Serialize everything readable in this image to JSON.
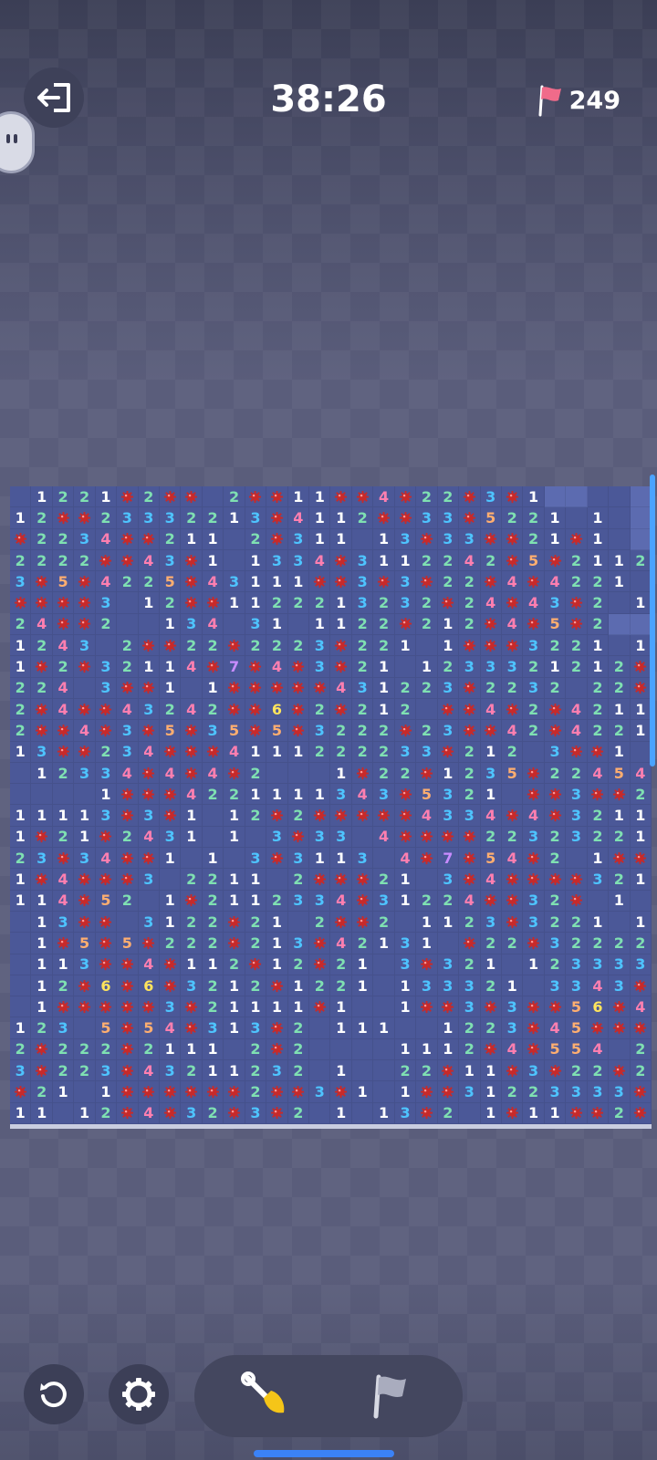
{
  "header": {
    "timer": "38:26",
    "flags_remaining": "249"
  },
  "icons": {
    "exit": "exit-icon",
    "mascot": "mascot-avatar",
    "flag": "flag-icon",
    "restart": "restart-icon",
    "settings": "gear-icon",
    "dig_mode": "shovel-icon",
    "flag_mode": "flag-mode-icon",
    "mine": "mine-icon"
  },
  "colors": {
    "1": "#ffffff",
    "2": "#7fe0b2",
    "3": "#4ec4ff",
    "4": "#ff7fb0",
    "5": "#ffae70",
    "6": "#ffe45c",
    "7": "#c98cff",
    "mine": "#c72a2a"
  },
  "board": {
    "cols": 30,
    "legend": "'.'=hidden, ' '=empty, 1-7=number, '*'=mine",
    "rows": [
      " 1221*2** 2**11**4*22*3*1..  .",
      "12**23332213*4112**33*5221 1 .",
      "*2234**211 2*311 13*33**21*1 .",
      "2222**43*1 1334*3112242*5*2112",
      "3*5*4225*43111**3*3*22*4*4221 ",
      "****3 12**1122213232*24*43*2 1",
      "24**2  134 31 1122*212*4*5*2..",
      "1243 2**22*2223*221 1***3221 1",
      "1*2*32114*7*4*3*21 1233321212*",
      "224 3**1 1*****431223*2232 22*",
      "2*4**43242**6*2*212 **4*2*4211",
      "2**4*3*5*35*5*3222*23**42*4221",
      "13**234***4111222233*212 3**1 ",
      " 12334*4*4*2   1*22*1235*22454",
      "    1***4221111343*5321 **3**2",
      "11113*3*1 12*2*****4334*4*3211",
      "1*21*2431 1 3*33 4****22323221",
      "23*34**1 1 3*3113 4*7*54*2 1**",
      "1*4***3 2211 2***21 3*4****321",
      "114*52 1*2112334*31224**32* 1 ",
      " 13** 3122*21 2**2 1123*3221 1",
      " 1*5*5*222*213*42131 *22*32222",
      " 113**4*112*12*21 3*321 123333",
      " 12*6*6*3212*1221 133321 3343*",
      " 1*****3*21111*1  1**3*3**56*4",
      "123 5*54*313*2 111  1223*45***",
      "2*222*2111 2*2    1112*4*554 2",
      "3*223*43211232 1  22*11*3*22*2",
      "*21 1******2**3*1 1**31223333*",
      "11 12*4*32*3*2 1 13*2 1*11**2*"
    ]
  }
}
